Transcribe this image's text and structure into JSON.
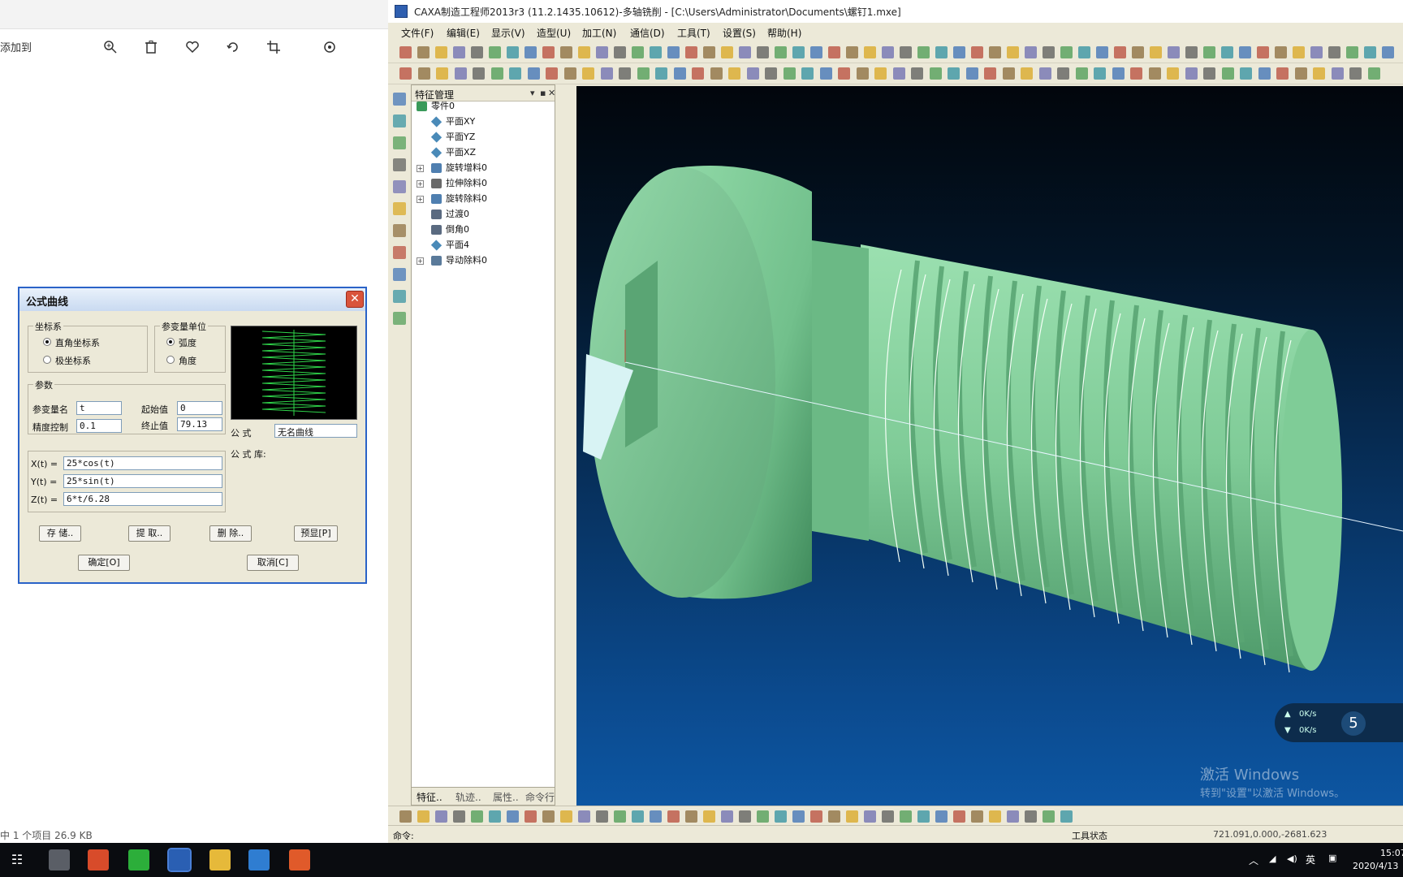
{
  "viewer": {
    "title_fragment": "添加到",
    "status": "中 1 个项目  26.9 KB",
    "tools": [
      "zoom-in-icon",
      "delete-icon",
      "favorite-icon",
      "rotate-icon",
      "crop-icon",
      "more-icon"
    ]
  },
  "dialog": {
    "title": "公式曲线",
    "close": "✕",
    "coord_group": "坐标系",
    "coord_options": [
      "直角坐标系",
      "极坐标系"
    ],
    "unit_group": "参变量单位",
    "unit_options": [
      "弧度",
      "角度"
    ],
    "params_group": "参数",
    "var_name_label": "参变量名",
    "var_name_value": "t",
    "start_label": "起始值",
    "start_value": "0",
    "precision_label": "精度控制",
    "precision_value": "0.1",
    "end_label": "终止值",
    "end_value": "79.13",
    "formula_label": "公 式",
    "formula_value": "无名曲线",
    "library_label": "公 式 库:",
    "x_label": "X(t) =",
    "x_value": "25*cos(t)",
    "y_label": "Y(t) =",
    "y_value": "25*sin(t)",
    "z_label": "Z(t) =",
    "z_value": "6*t/6.28",
    "buttons": [
      "存 储..",
      "提 取..",
      "删 除..",
      "预显[P]"
    ],
    "ok": "确定[O]",
    "cancel": "取消[C]"
  },
  "caxa": {
    "title": "CAXA制造工程师2013r3 (11.2.1435.10612)-多轴铣削 - [C:\\Users\\Administrator\\Documents\\螺钉1.mxe]",
    "menus": [
      "文件(F)",
      "编辑(E)",
      "显示(V)",
      "造型(U)",
      "加工(N)",
      "通信(D)",
      "工具(T)",
      "设置(S)",
      "帮助(H)"
    ],
    "panel_title": "特征管理",
    "tree": [
      {
        "label": "零件0",
        "level": 0,
        "icon": "part-icon",
        "expandable": false
      },
      {
        "label": "平面XY",
        "level": 1,
        "icon": "plane-icon",
        "expandable": false
      },
      {
        "label": "平面YZ",
        "level": 1,
        "icon": "plane-icon",
        "expandable": false
      },
      {
        "label": "平面XZ",
        "level": 1,
        "icon": "plane-icon",
        "expandable": false
      },
      {
        "label": "旋转增料0",
        "level": 1,
        "icon": "revolve-add-icon",
        "expandable": true
      },
      {
        "label": "拉伸除料0",
        "level": 1,
        "icon": "extrude-cut-icon",
        "expandable": true
      },
      {
        "label": "旋转除料0",
        "level": 1,
        "icon": "revolve-cut-icon",
        "expandable": true
      },
      {
        "label": "过渡0",
        "level": 1,
        "icon": "fillet-icon",
        "expandable": false
      },
      {
        "label": "倒角0",
        "level": 1,
        "icon": "chamfer-icon",
        "expandable": false
      },
      {
        "label": "平面4",
        "level": 1,
        "icon": "plane-icon",
        "expandable": false
      },
      {
        "label": "导动除料0",
        "level": 1,
        "icon": "sweep-cut-icon",
        "expandable": true
      }
    ],
    "panel_tabs": [
      "特征..",
      "轨迹..",
      "属性..",
      "命令行"
    ],
    "command_label": "命令:",
    "tool_status": "工具状态",
    "coords": "721.091,0.000,-2681.623",
    "watermark1": "激活 Windows",
    "watermark2": "转到\"设置\"以激活 Windows。",
    "speed_up": "0K/s",
    "speed_down": "0K/s",
    "speed_badge": "5"
  },
  "taskbar": {
    "ime": "英",
    "time": "15:07",
    "date": "2020/4/13"
  },
  "colors": {
    "screw": "#8fd6a8",
    "viewport_bottom": "#0d56a2",
    "dialog_border": "#2a63c8"
  }
}
